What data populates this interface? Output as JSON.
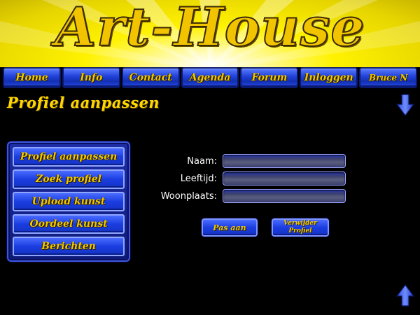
{
  "banner": {
    "logo_text": "Art-House"
  },
  "nav": {
    "items": [
      {
        "label": "Home",
        "name": "nav-home"
      },
      {
        "label": "Info",
        "name": "nav-info"
      },
      {
        "label": "Contact",
        "name": "nav-contact"
      },
      {
        "label": "Agenda",
        "name": "nav-agenda"
      },
      {
        "label": "Forum",
        "name": "nav-forum"
      },
      {
        "label": "Inloggen",
        "name": "nav-inloggen"
      },
      {
        "label": "Bruce N",
        "name": "nav-user"
      }
    ]
  },
  "page": {
    "title": "Profiel aanpassen"
  },
  "side_menu": {
    "items": [
      {
        "label": "Profiel aanpassen"
      },
      {
        "label": "Zoek profiel"
      },
      {
        "label": "Upload kunst"
      },
      {
        "label": "Oordeel kunst"
      },
      {
        "label": "Berichten"
      }
    ]
  },
  "form": {
    "fields": [
      {
        "label": "Naam:",
        "value": ""
      },
      {
        "label": "Leeftijd:",
        "value": ""
      },
      {
        "label": "Woonplaats:",
        "value": ""
      }
    ],
    "save_label": "Pas aan",
    "delete_label_line1": "Verwijder",
    "delete_label_line2": "Profiel"
  },
  "icons": {
    "scroll_down": "arrow-down-icon",
    "scroll_up": "arrow-up-icon"
  },
  "colors": {
    "banner_yellow": "#fff200",
    "button_blue": "#1f3fd6",
    "label_gold": "#f0c800",
    "background": "#000000"
  }
}
